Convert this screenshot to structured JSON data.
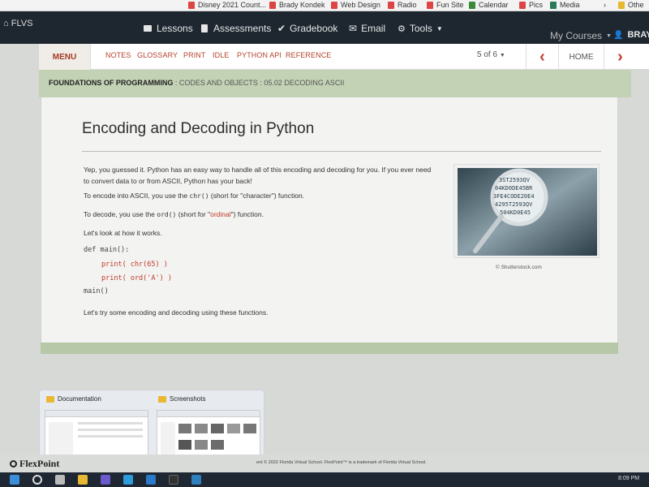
{
  "bookmarks": [
    {
      "label": "Disney 2021 Count...",
      "color": "#d44"
    },
    {
      "label": "Brady Kondek",
      "color": "#d44"
    },
    {
      "label": "Web Design",
      "color": "#d44"
    },
    {
      "label": "Radio",
      "color": "#d44"
    },
    {
      "label": "Fun Site",
      "color": "#d44"
    },
    {
      "label": "Calendar",
      "color": "#3a8a3a"
    },
    {
      "label": "Pics",
      "color": "#d44"
    },
    {
      "label": "Media",
      "color": "#2a7a5a"
    },
    {
      "label": "Othe",
      "color": "#e8b833"
    }
  ],
  "topnav": {
    "brand": "FLVS",
    "lessons": "Lessons",
    "assessments": "Assessments",
    "gradebook": "Gradebook",
    "email": "Email",
    "tools": "Tools",
    "my_courses": "My Courses",
    "user": "BRAYDE"
  },
  "menubar": {
    "menu": "MENU",
    "links": [
      "NOTES",
      "GLOSSARY",
      "PRINT",
      "IDLE",
      "PYTHON API",
      "REFERENCE"
    ],
    "page_indicator": "5 of 6",
    "home": "HOME"
  },
  "breadcrumb": {
    "course": "FOUNDATIONS OF PROGRAMMING",
    "rest": ": CODES AND OBJECTS : 05.02 DECODING ASCII"
  },
  "content": {
    "title": "Encoding and Decoding in Python",
    "p1": "Yep, you guessed it. Python has an easy way to handle all of this encoding and decoding for you. If you ever need to convert data to or from ASCII, Python has your back!",
    "p2_a": "To encode into ASCII, you use the ",
    "p2_code": "chr()",
    "p2_b": " (short for \"character\") function.",
    "p3_a": "To decode, you use the ",
    "p3_code": "ord()",
    "p3_b": " (short for \"",
    "p3_red": "ordinal",
    "p3_c": "\") function.",
    "p4": "Let's look at how it works.",
    "code": [
      "def main():",
      "print( chr(65) )",
      "print( ord('A') )",
      "main()"
    ],
    "p5": "Let's try some encoding and decoding using these functions.",
    "image_credit": "© Shutterstock.com",
    "image_lines": [
      "3ST2593QV",
      "04KD0DE45BR",
      "3FE4CODE20E4",
      "4295T2593QV",
      "504KD0E45"
    ]
  },
  "thumbnails": [
    {
      "label": "Documentation"
    },
    {
      "label": "Screenshots"
    }
  ],
  "footer": {
    "logo": "FlexPoint",
    "text": "ent © 2022 Florida Virtual School. FlexPoint™ is a trademark of Florida Virtual School."
  },
  "taskbar": {
    "clock": "8:09 PM"
  }
}
